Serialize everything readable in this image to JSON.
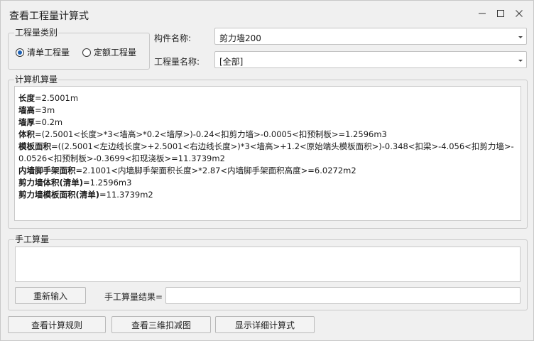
{
  "window": {
    "title": "查看工程量计算式"
  },
  "quantity_type": {
    "legend": "工程量类别",
    "options": [
      {
        "label": "清单工程量",
        "checked": true
      },
      {
        "label": "定额工程量",
        "checked": false
      }
    ]
  },
  "component": {
    "label": "构件名称:",
    "value": "剪力墙200"
  },
  "quantity_name": {
    "label": "工程量名称:",
    "value": "[全部]"
  },
  "computer_calc": {
    "legend": "计算机算量",
    "lines": [
      {
        "key": "长度",
        "expr": "=2.5001m"
      },
      {
        "key": "墙高",
        "expr": "=3m"
      },
      {
        "key": "墙厚",
        "expr": "=0.2m"
      },
      {
        "key": "体积",
        "expr": "=(2.5001<长度>*3<墙高>*0.2<墙厚>)-0.24<扣剪力墙>-0.0005<扣预制板>=1.2596m3"
      },
      {
        "key": "模板面积",
        "expr": "=((2.5001<左边线长度>+2.5001<右边线长度>)*3<墙高>+1.2<原始端头模板面积>)-0.348<扣梁>-4.056<扣剪力墙>-0.0526<扣预制板>-0.3699<扣现浇板>=11.3739m2"
      },
      {
        "key": "内墙脚手架面积",
        "expr": "=2.1001<内墙脚手架面积长度>*2.87<内墙脚手架面积高度>=6.0272m2"
      },
      {
        "key": "剪力墙体积(清单)",
        "expr": "=1.2596m3"
      },
      {
        "key": "剪力墙模板面积(清单)",
        "expr": "=11.3739m2"
      }
    ]
  },
  "manual_calc": {
    "legend": "手工算量",
    "reenter_button": "重新输入",
    "result_label": "手工算量结果=",
    "result_value": ""
  },
  "footer": {
    "view_rules_button": "查看计算规则",
    "view_3d_button": "查看三维扣减图",
    "show_detail_button": "显示详细计算式"
  }
}
